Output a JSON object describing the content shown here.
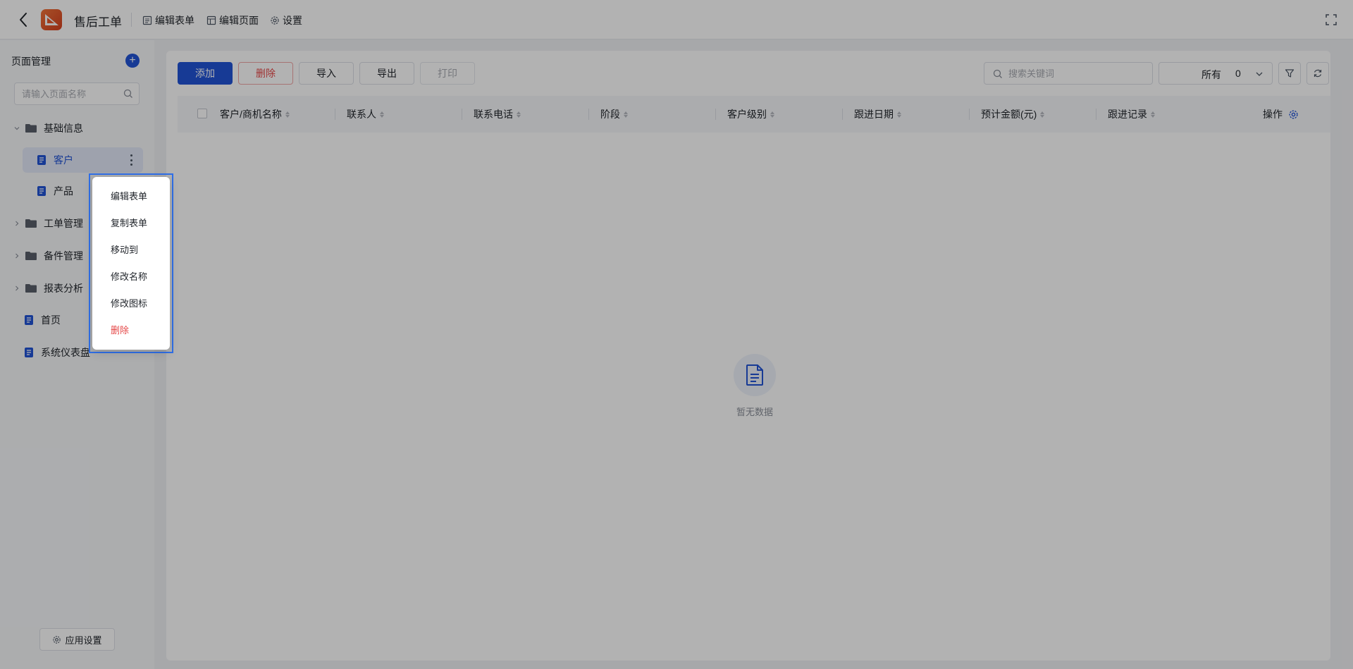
{
  "header": {
    "app_title": "售后工单",
    "tools": [
      {
        "label": "编辑表单",
        "icon": "form-icon"
      },
      {
        "label": "编辑页面",
        "icon": "layout-icon"
      },
      {
        "label": "设置",
        "icon": "gear-icon"
      }
    ]
  },
  "sidebar": {
    "title": "页面管理",
    "search_placeholder": "请输入页面名称",
    "tree": [
      {
        "label": "基础信息",
        "type": "folder",
        "expanded": true
      },
      {
        "label": "客户",
        "type": "page",
        "active": true
      },
      {
        "label": "产品",
        "type": "page"
      },
      {
        "label": "工单管理",
        "type": "folder",
        "expanded": false
      },
      {
        "label": "备件管理",
        "type": "folder",
        "expanded": false
      },
      {
        "label": "报表分析",
        "type": "folder",
        "expanded": false
      },
      {
        "label": "首页",
        "type": "page"
      },
      {
        "label": "系统仪表盘",
        "type": "page"
      }
    ],
    "app_settings_label": "应用设置"
  },
  "toolbar": {
    "add": "添加",
    "delete": "删除",
    "import": "导入",
    "export": "导出",
    "print": "打印",
    "search_placeholder": "搜索关键词",
    "filter_scope": "所有",
    "filter_count": "0"
  },
  "table": {
    "columns": [
      "客户/商机名称",
      "联系人",
      "联系电话",
      "阶段",
      "客户级别",
      "跟进日期",
      "预计金额(元)",
      "跟进记录"
    ],
    "actions_label": "操作",
    "empty_text": "暂无数据"
  },
  "context_menu": {
    "items": [
      "编辑表单",
      "复制表单",
      "移动到",
      "修改名称",
      "修改图标",
      "删除"
    ]
  },
  "colors": {
    "primary": "#2254d6",
    "danger": "#e54848",
    "focus_border": "#2f6fe8"
  }
}
